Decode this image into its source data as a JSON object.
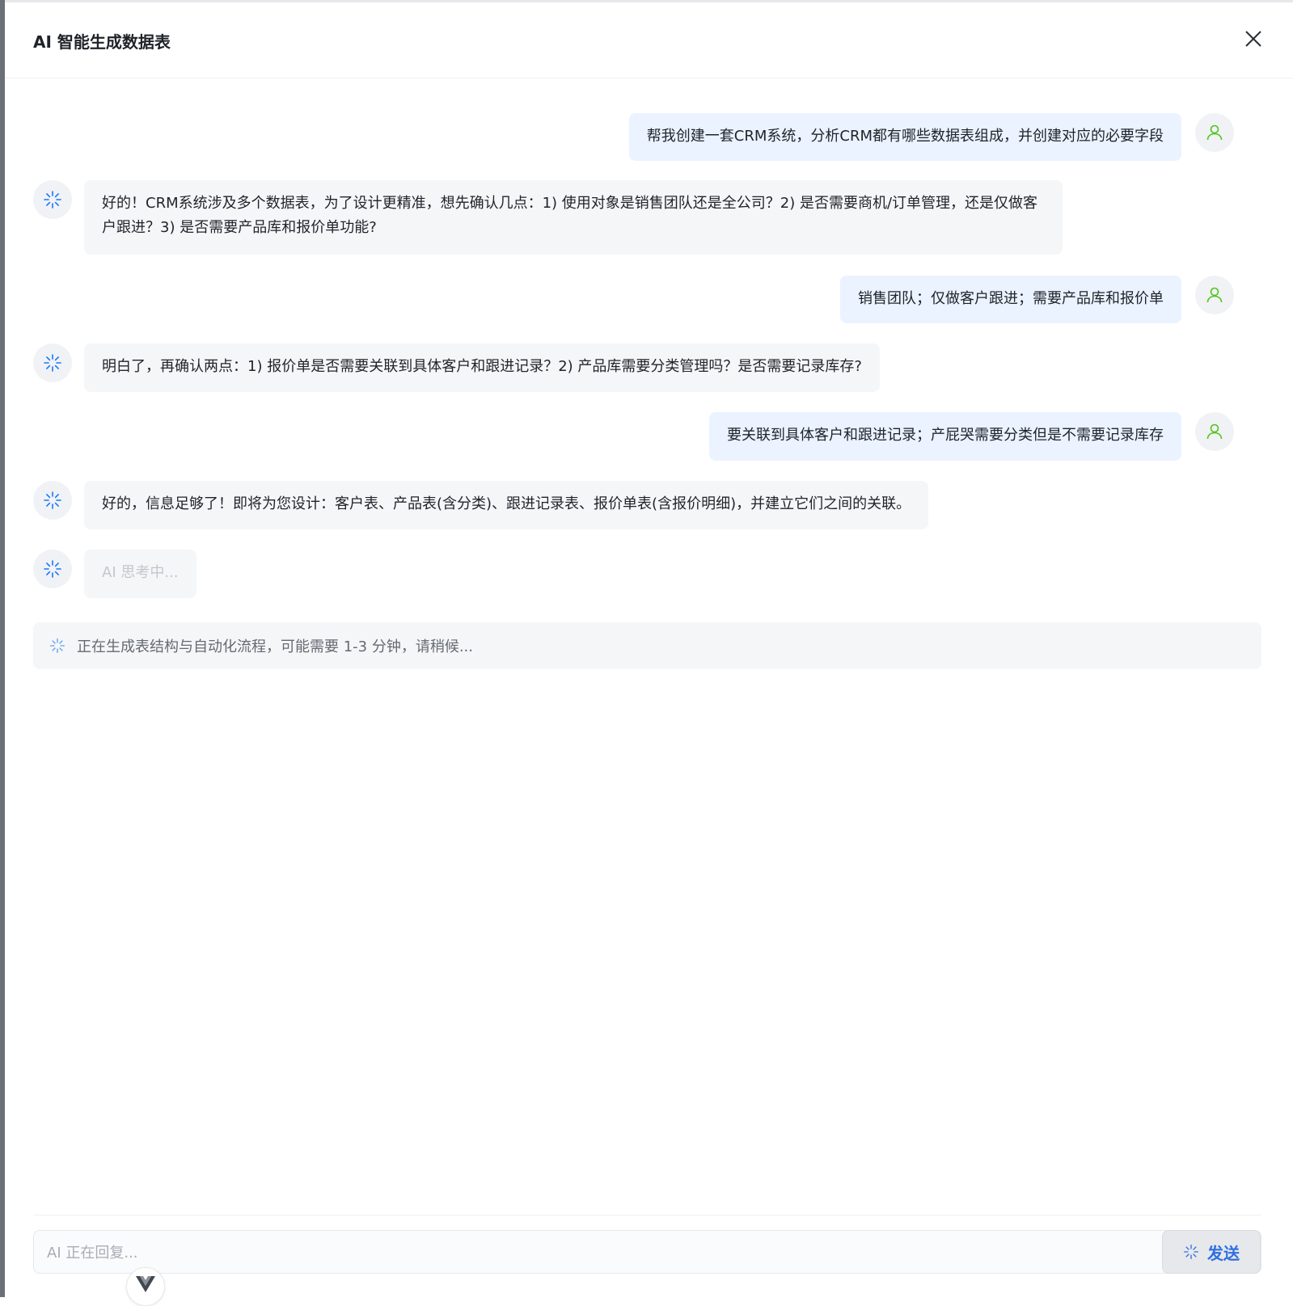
{
  "dialog": {
    "title": "AI 智能生成数据表",
    "close_icon": "close-icon"
  },
  "messages": [
    {
      "role": "user",
      "text": "帮我创建一套CRM系统，分析CRM都有哪些数据表组成，并创建对应的必要字段"
    },
    {
      "role": "ai",
      "text": "好的！CRM系统涉及多个数据表，为了设计更精准，想先确认几点：1) 使用对象是销售团队还是全公司？2) 是否需要商机/订单管理，还是仅做客户跟进？3) 是否需要产品库和报价单功能?"
    },
    {
      "role": "user",
      "text": "销售团队；仅做客户跟进；需要产品库和报价单"
    },
    {
      "role": "ai",
      "text": "明白了，再确认两点：1) 报价单是否需要关联到具体客户和跟进记录？2) 产品库需要分类管理吗？是否需要记录库存?"
    },
    {
      "role": "user",
      "text": "要关联到具体客户和跟进记录；产屁哭需要分类但是不需要记录库存"
    },
    {
      "role": "ai",
      "text": "好的，信息足够了！即将为您设计：客户表、产品表(含分类)、跟进记录表、报价单表(含报价明细)，并建立它们之间的关联。"
    },
    {
      "role": "ai",
      "text": "AI 思考中..."
    }
  ],
  "status": {
    "text": "正在生成表结构与自动化流程，可能需要 1-3 分钟，请稍候..."
  },
  "composer": {
    "placeholder": "AI 正在回复...",
    "send_label": "发送"
  },
  "colors": {
    "user_bubble": "#eaf3ff",
    "ai_bubble": "#f5f6f8",
    "user_avatar_icon": "#52c41a",
    "ai_avatar_icon": "#1677ff",
    "send_accent": "#2f6fe0"
  },
  "icons": {
    "user_avatar": "user-icon",
    "ai_avatar": "sparkle-spinner-icon",
    "vue_badge": "vue-logo-icon"
  }
}
